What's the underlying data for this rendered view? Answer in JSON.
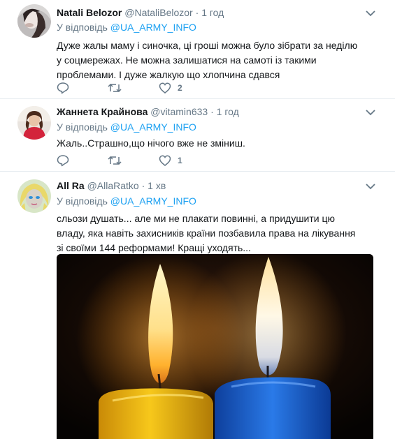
{
  "tweets": [
    {
      "name": "Natali Belozor",
      "handle": "@NataliBelozor",
      "time": "1 год",
      "reply_prefix": "У відповідь",
      "reply_to": "@UA_ARMY_INFO",
      "text": "Дуже жалы маму і синочка, ці гроші можна було зібрати за неділю у соцмережах. Не можна залишатися на самоті із такими проблемами.  І дуже жалкую що хлопчина сдався",
      "likes": "2"
    },
    {
      "name": "Жаннета Крайнова",
      "handle": "@vitamin633",
      "time": "1 год",
      "reply_prefix": "У відповідь",
      "reply_to": "@UA_ARMY_INFO",
      "text": "Жаль..Страшно,що нічого вже не зміниш.",
      "likes": "1"
    },
    {
      "name": "All Ra",
      "handle": "@AllaRatko",
      "time": "1 хв",
      "reply_prefix": "У відповідь",
      "reply_to": "@UA_ARMY_INFO",
      "text": "сльози душать... але ми не плакати повинні, а придушити цю владу, яка навіть захисників країни позбавила права на лікування зі своїми 144 реформами! Кращі уходять..."
    }
  ],
  "separator": "·",
  "colors": {
    "link": "#1da1f2",
    "muted": "#657786",
    "text": "#14171a",
    "divider": "#e6ecf0",
    "candle_yellow": "#f2c10f",
    "candle_blue": "#1c64d8"
  },
  "icons": [
    "chevron-down-icon",
    "reply-icon",
    "retweet-icon",
    "like-icon"
  ]
}
